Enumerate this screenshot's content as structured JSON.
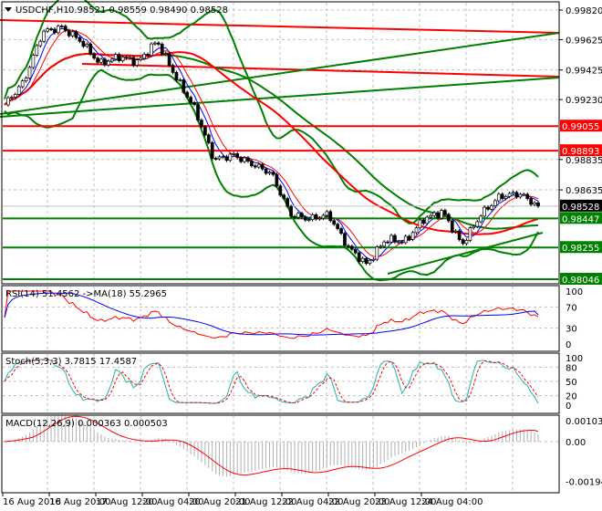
{
  "header": {
    "symbol": "USDCHF,H1",
    "ohlc": "0.98521 0.98559 0.98490 0.98528"
  },
  "chart_data": {
    "type": "line",
    "title": "USDCHF,H1",
    "series_name": "Close",
    "close": [
      0.99195,
      0.99345,
      0.99676,
      0.99706,
      0.99616,
      0.99465,
      0.99513,
      0.99477,
      0.99616,
      0.99375,
      0.99164,
      0.98834,
      0.98864,
      0.98804,
      0.98744,
      0.98473,
      0.98443,
      0.98473,
      0.98262,
      0.98142,
      0.9831,
      0.98293,
      0.98443,
      0.98491,
      0.98274,
      0.98473,
      0.98593,
      0.98611,
      0.98528
    ],
    "ylim": [
      0.9803,
      0.9985
    ],
    "price_ticks": [
      "0.99820",
      "0.99625",
      "0.99425",
      "0.99230",
      "0.98835",
      "0.98635"
    ],
    "levels": [
      {
        "label": "0.99055",
        "value": 0.99055,
        "color": "#ff0000"
      },
      {
        "label": "0.98893",
        "value": 0.98893,
        "color": "#ff0000"
      },
      {
        "label": "0.98528",
        "value": 0.98528,
        "color": "#000000"
      },
      {
        "label": "0.98447",
        "value": 0.98447,
        "color": "#008000"
      },
      {
        "label": "0.98255",
        "value": 0.98255,
        "color": "#008000"
      },
      {
        "label": "0.98046",
        "value": 0.98046,
        "color": "#008000"
      }
    ],
    "x_ticks": [
      "16 Aug 2018",
      "16 Aug 20:00",
      "17 Aug 12:00",
      "20 Aug 04:00",
      "20 Aug 20:00",
      "21 Aug 12:00",
      "22 Aug 04:00",
      "22 Aug 20:00",
      "23 Aug 12:00",
      "24 Aug 04:00"
    ],
    "rsi": {
      "label": "RSI(14) 51.4562  ->MA(18) 55.2965",
      "ticks": [
        "100",
        "70",
        "30",
        "0"
      ],
      "value": 51.4562,
      "ma": 55.2965
    },
    "stoch": {
      "label": "Stoch(5,3,3) 3.7815 17.4587",
      "ticks": [
        "100",
        "80",
        "50",
        "20",
        "0"
      ],
      "main": 3.7815,
      "signal": 17.4587
    },
    "macd": {
      "label": "MACD(12,26,9) 0.000363 0.000503",
      "ticks": [
        "0.001033",
        "0.00",
        "-0.001945"
      ],
      "main": 0.000363,
      "signal": 0.000503
    }
  }
}
